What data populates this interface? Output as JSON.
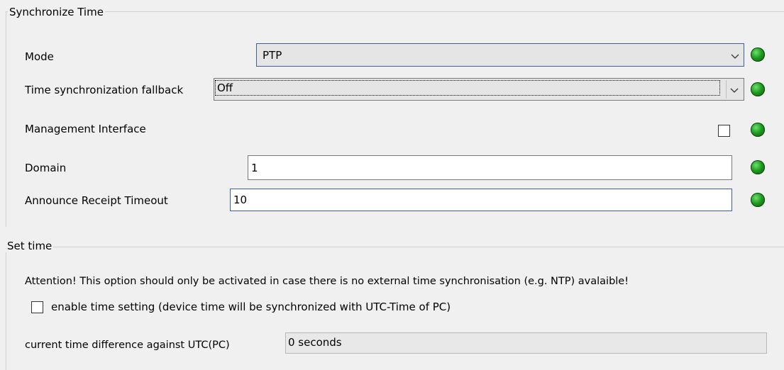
{
  "sync": {
    "title": "Synchronize Time",
    "mode": {
      "label": "Mode",
      "value": "PTP"
    },
    "fallback": {
      "label": "Time synchronization fallback",
      "value": "Off"
    },
    "mgmt": {
      "label": "Management Interface",
      "checked": false
    },
    "domain": {
      "label": "Domain",
      "value": "1"
    },
    "announce": {
      "label": "Announce Receipt Timeout",
      "value": "10"
    },
    "status_color": "#1f9a1f"
  },
  "set_time": {
    "title": "Set time",
    "attention": "Attention! This option should only be activated in case there is no external time synchronisation (e.g. NTP) avalaible!",
    "enable_label": "enable time setting (device time will be synchronized with UTC-Time of PC)",
    "enable_checked": false,
    "diff_label": "current time difference against UTC(PC)",
    "diff_value": "0 seconds"
  }
}
